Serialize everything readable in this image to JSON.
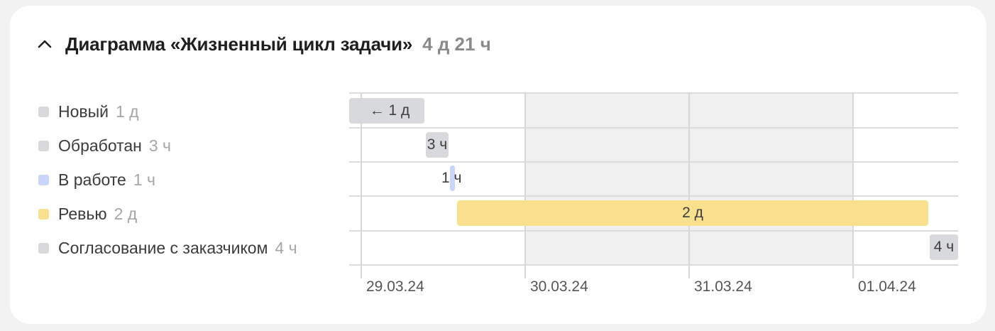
{
  "header": {
    "title": "Диаграмма «Жизненный цикл задачи»",
    "total": "4 д 21 ч"
  },
  "legend": [
    {
      "label": "Новый",
      "duration": "1 д",
      "color": "#d8d9dc"
    },
    {
      "label": "Обработан",
      "duration": "3 ч",
      "color": "#d8d9dc"
    },
    {
      "label": "В работе",
      "duration": "1 ч",
      "color": "#c9d6fa"
    },
    {
      "label": "Ревью",
      "duration": "2 д",
      "color": "#f8e08e"
    },
    {
      "label": "Согласование с заказчиком",
      "duration": "4 ч",
      "color": "#d8d9dc"
    }
  ],
  "bars": [
    {
      "label": "← 1 д"
    },
    {
      "label": "3 ч"
    },
    {
      "label": "1 ч"
    },
    {
      "label": "2 д"
    },
    {
      "label": "4 ч"
    }
  ],
  "ticks": [
    "29.03.24",
    "30.03.24",
    "31.03.24",
    "01.04.24"
  ],
  "colors": {
    "grey_bar": "#d8d9dc",
    "blue_bar": "#c9d6fa",
    "yellow_bar": "#f8e08e",
    "weekend_bg": "#f0f0f0"
  }
}
